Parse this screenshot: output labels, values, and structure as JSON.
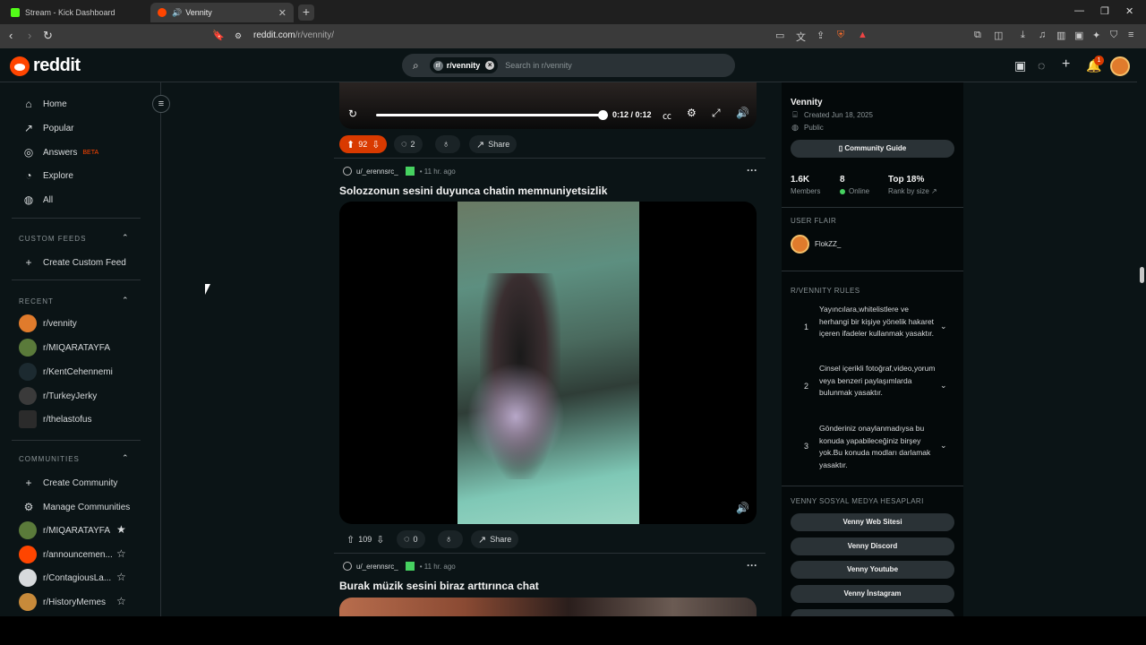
{
  "browser": {
    "tabs": [
      {
        "label": "Stream - Kick Dashboard",
        "icon": "kick-icon",
        "color": "#53fc18"
      },
      {
        "label": "Vennity",
        "icon": "reddit-icon",
        "color": "#ff4500",
        "active": true
      }
    ],
    "url_host": "reddit.com",
    "url_path": "/r/vennity/",
    "ext_badge": "1"
  },
  "header": {
    "logo": "reddit",
    "search_chip": "r/vennity",
    "search_placeholder": "Search in r/vennity",
    "notif_count": "1"
  },
  "sidebar": {
    "nav": [
      {
        "label": "Home",
        "icon": "home-icon"
      },
      {
        "label": "Popular",
        "icon": "popular-icon"
      },
      {
        "label": "Answers",
        "icon": "answers-icon",
        "badge": "BETA"
      },
      {
        "label": "Explore",
        "icon": "explore-icon"
      },
      {
        "label": "All",
        "icon": "all-icon"
      }
    ],
    "custom_feeds_title": "CUSTOM FEEDS",
    "create_custom_feed": "Create Custom Feed",
    "recent_title": "RECENT",
    "recent": [
      "r/vennity",
      "r/MIQARATAYFA",
      "r/KentCehennemi",
      "r/TurkeyJerky",
      "r/thelastofus"
    ],
    "communities_title": "COMMUNITIES",
    "create_community": "Create Community",
    "manage_communities": "Manage Communities",
    "communities": [
      {
        "label": "r/MIQARATAYFA",
        "starred": true
      },
      {
        "label": "r/announcemen...",
        "starred": false
      },
      {
        "label": "r/ContagiousLa...",
        "starred": false
      },
      {
        "label": "r/HistoryMemes",
        "starred": false
      }
    ]
  },
  "posts": [
    {
      "video_time": "0:12 / 0:12",
      "progress": 1.0,
      "upvotes": "92",
      "comments": "2",
      "share": "Share",
      "voted_up": true
    },
    {
      "author": "u/_erennsrc_",
      "time": "11 hr. ago",
      "title": "Solozzonun sesini duyunca chatin memnuniyetsizlik",
      "upvotes": "109",
      "comments": "0",
      "share": "Share"
    },
    {
      "author": "u/_erennsrc_",
      "time": "11 hr. ago",
      "title": "Burak müzik sesini biraz arttırınca chat"
    }
  ],
  "community": {
    "name": "Vennity",
    "created": "Created Jun 18, 2025",
    "visibility": "Public",
    "guide_button": "Community Guide",
    "stats": [
      {
        "value": "1.6K",
        "label": "Members"
      },
      {
        "value": "8",
        "label": "Online"
      },
      {
        "value": "Top 18%",
        "label": "Rank by size"
      }
    ],
    "user_flair_title": "USER FLAIR",
    "user_flair": "FlokZZ_",
    "rules_title": "R/VENNITY RULES",
    "rules": [
      {
        "n": "1",
        "text": "Yayıncılara,whitelistlere ve herhangi bir kişiye yönelik hakaret içeren ifadeler kullanmak yasaktır."
      },
      {
        "n": "2",
        "text": "Cinsel içerikli fotoğraf,video,yorum veya benzeri paylaşımlarda bulunmak yasaktır."
      },
      {
        "n": "3",
        "text": "Gönderiniz onaylanmadıysa bu konuda yapabileceğiniz birşey yok.Bu konuda modları darlamak yasaktır."
      }
    ],
    "social_title": "VENNY SOSYAL MEDYA HESAPLARI",
    "social_links": [
      "Venny Web Sitesi",
      "Venny Discord",
      "Venny Youtube",
      "Venny İnstagram"
    ]
  }
}
